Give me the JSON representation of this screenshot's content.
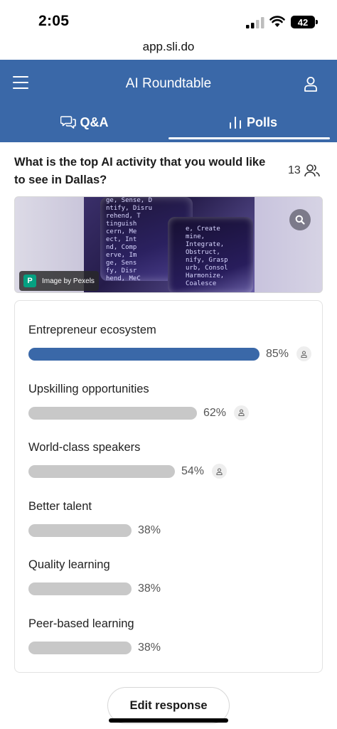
{
  "status_bar": {
    "time": "2:05",
    "battery": "42"
  },
  "browser": {
    "url": "app.sli.do"
  },
  "header": {
    "title": "AI Roundtable",
    "menu_icon": "hamburger-menu-icon",
    "user_icon": "user-icon"
  },
  "tabs": [
    {
      "label": "Q&A",
      "icon": "chat-bubbles-icon",
      "active": false
    },
    {
      "label": "Polls",
      "icon": "bar-chart-icon",
      "active": true
    }
  ],
  "poll": {
    "question": "What is the top AI activity that you would like to see in Dallas?",
    "participants": "13",
    "image_credit": "Image by Pexels",
    "image_code_left": "ge, Sense, D\nntify, Disru\nrehend, T\ntinguish\ncern, Me\nect, Int\nnd, Comp\nerve, Im\nge, Sens\nfy, Disr\nhend, MeC",
    "image_code_right": "e, Create\nmine,\nIntegrate,\nObstruct,\nnify, Grasp\nurb, Consol\nHarmonize,\nCoalesce",
    "options": [
      {
        "label": "Entrepreneur ecosystem",
        "percent": 85,
        "percent_text": "85%",
        "voted": true,
        "top": true
      },
      {
        "label": "Upskilling opportunities",
        "percent": 62,
        "percent_text": "62%",
        "voted": true,
        "top": false
      },
      {
        "label": "World-class speakers",
        "percent": 54,
        "percent_text": "54%",
        "voted": true,
        "top": false
      },
      {
        "label": "Better talent",
        "percent": 38,
        "percent_text": "38%",
        "voted": false,
        "top": false
      },
      {
        "label": "Quality learning",
        "percent": 38,
        "percent_text": "38%",
        "voted": false,
        "top": false
      },
      {
        "label": "Peer-based learning",
        "percent": 38,
        "percent_text": "38%",
        "voted": false,
        "top": false
      }
    ],
    "edit_button": "Edit response"
  },
  "colors": {
    "brand": "#3a68a8",
    "bar_default": "#c8c8c8",
    "pexels": "#05a081"
  }
}
